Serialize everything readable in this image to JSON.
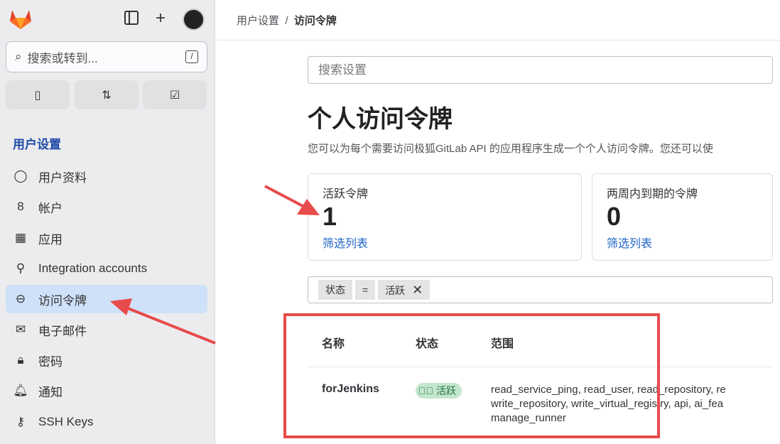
{
  "sidebar": {
    "search_placeholder": "搜索或转到...",
    "search_shortcut": "/",
    "section_title": "用户设置",
    "items": [
      {
        "label": "用户资料",
        "icon": "user-icon"
      },
      {
        "label": "帐户",
        "icon": "account-icon"
      },
      {
        "label": "应用",
        "icon": "applications-icon"
      },
      {
        "label": "Integration accounts",
        "icon": "integration-icon"
      },
      {
        "label": "访问令牌",
        "icon": "token-icon"
      },
      {
        "label": "电子邮件",
        "icon": "mail-icon"
      },
      {
        "label": "密码",
        "icon": "lock-icon"
      },
      {
        "label": "通知",
        "icon": "bell-icon"
      },
      {
        "label": "SSH Keys",
        "icon": "key-icon"
      }
    ]
  },
  "breadcrumb": {
    "parent": "用户设置",
    "sep": "/",
    "current": "访问令牌"
  },
  "settings_search_placeholder": "搜索设置",
  "title": "个人访问令牌",
  "description": "您可以为每个需要访问极狐GitLab API 的应用程序生成一个个人访问令牌。您还可以使",
  "cards": [
    {
      "title": "活跃令牌",
      "count": "1",
      "link": "筛选列表"
    },
    {
      "title": "两周内到期的令牌",
      "count": "0",
      "link": "筛选列表"
    }
  ],
  "filter": {
    "field": "状态",
    "op": "=",
    "value": "活跃"
  },
  "table": {
    "headers": [
      "名称",
      "状态",
      "范围"
    ],
    "rows": [
      {
        "name": "forJenkins",
        "status": "活跃",
        "scopes": [
          "read_service_ping, read_user, read_repository, re",
          "write_repository, write_virtual_registry, api, ai_fea",
          "manage_runner"
        ]
      }
    ]
  },
  "colors": {
    "accent": "#1f65c7",
    "annotation": "#e84b4b",
    "active_bg": "#cfe1f8"
  }
}
